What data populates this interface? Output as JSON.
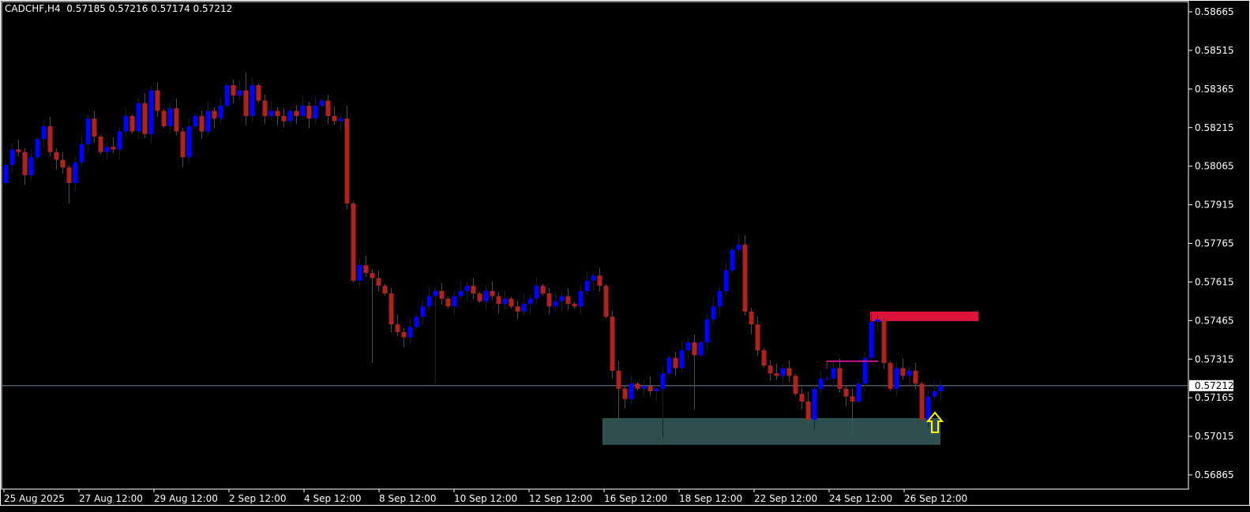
{
  "header": {
    "symbol": "CADCHF,H4",
    "open": "0.57185",
    "high": "0.57216",
    "low": "0.57174",
    "close": "0.57212"
  },
  "colors": {
    "bull": "#0000ff",
    "bear": "#b22222",
    "background": "#000000",
    "zone_support": "#2f4f4f",
    "zone_resistance": "#dc143c",
    "level_line": "#c71585",
    "arrow": "#ffff00",
    "price_line": "#778899"
  },
  "chart_data": {
    "type": "candlestick",
    "title": "CADCHF,H4",
    "ylim": [
      0.56865,
      0.58665
    ],
    "y_ticks": [
      "0.58665",
      "0.58515",
      "0.58365",
      "0.58215",
      "0.58065",
      "0.57915",
      "0.57765",
      "0.57615",
      "0.57465",
      "0.57315",
      "0.57165",
      "0.57015",
      "0.56865"
    ],
    "x_ticks": [
      "25 Aug 2025",
      "27 Aug 12:00",
      "29 Aug 12:00",
      "2 Sep 12:00",
      "4 Sep 12:00",
      "8 Sep 12:00",
      "10 Sep 12:00",
      "12 Sep 12:00",
      "16 Sep 12:00",
      "18 Sep 12:00",
      "22 Sep 12:00",
      "24 Sep 12:00",
      "26 Sep 12:00"
    ],
    "first_open": 0.58,
    "close": [
      0.5807,
      0.5813,
      0.5812,
      0.5803,
      0.581,
      0.5817,
      0.5822,
      0.5812,
      0.5809,
      0.5806,
      0.58,
      0.5808,
      0.5815,
      0.5825,
      0.5818,
      0.5812,
      0.5814,
      0.5813,
      0.582,
      0.5826,
      0.582,
      0.5831,
      0.5819,
      0.5836,
      0.5828,
      0.5822,
      0.5829,
      0.582,
      0.581,
      0.5822,
      0.5826,
      0.582,
      0.5828,
      0.5825,
      0.583,
      0.5838,
      0.5834,
      0.5836,
      0.5826,
      0.5838,
      0.5832,
      0.5826,
      0.5828,
      0.5826,
      0.5824,
      0.5828,
      0.5826,
      0.583,
      0.5825,
      0.583,
      0.5832,
      0.5826,
      0.5824,
      0.5825,
      0.5792,
      0.5762,
      0.5768,
      0.5765,
      0.5763,
      0.576,
      0.5757,
      0.5745,
      0.5742,
      0.574,
      0.5744,
      0.5748,
      0.5752,
      0.5756,
      0.5758,
      0.5755,
      0.5752,
      0.5756,
      0.5758,
      0.576,
      0.5757,
      0.5754,
      0.5758,
      0.5756,
      0.5753,
      0.5755,
      0.5752,
      0.575,
      0.5753,
      0.5755,
      0.576,
      0.5757,
      0.5752,
      0.5754,
      0.5756,
      0.5753,
      0.5752,
      0.5758,
      0.5762,
      0.5764,
      0.576,
      0.5748,
      0.5727,
      0.572,
      0.5716,
      0.5722,
      0.572,
      0.5721,
      0.5719,
      0.572,
      0.5726,
      0.5732,
      0.5728,
      0.5735,
      0.5738,
      0.5733,
      0.5738,
      0.5747,
      0.5752,
      0.5758,
      0.5766,
      0.5774,
      0.5776,
      0.575,
      0.5745,
      0.5735,
      0.5729,
      0.5726,
      0.5725,
      0.5728,
      0.5725,
      0.5718,
      0.5715,
      0.5708,
      0.572,
      0.5724,
      0.5724,
      0.5728,
      0.572,
      0.5717,
      0.5715,
      0.5722,
      0.5732,
      0.5746,
      0.5747,
      0.573,
      0.572,
      0.5728,
      0.5725,
      0.5727,
      0.5722,
      0.5708,
      0.5717,
      0.5719,
      0.57212
    ],
    "wick": 0.0003,
    "extreme_highs": {
      "38": 0.5843,
      "54": 0.583,
      "116": 0.578,
      "137": 0.5749
    },
    "extreme_lows": {
      "10": 0.5792,
      "58": 0.573,
      "68": 0.5722,
      "97": 0.5708,
      "104": 0.5701,
      "109": 0.5712,
      "127": 0.5706,
      "134": 0.5702,
      "145": 0.5706
    },
    "current_price": 0.57212,
    "current_price_label": "0.57212",
    "support_zone": {
      "top": 0.57086,
      "bottom": 0.56982,
      "from_index": 95,
      "to_index": 148
    },
    "resistance_zone": {
      "top": 0.575,
      "bottom": 0.57463,
      "from_index": 137,
      "to_index": 154
    },
    "level_line": {
      "price": 0.57307,
      "from_index": 130,
      "to_index": 138
    },
    "arrow": {
      "index": 147,
      "direction": "up",
      "price": 0.57115
    }
  }
}
